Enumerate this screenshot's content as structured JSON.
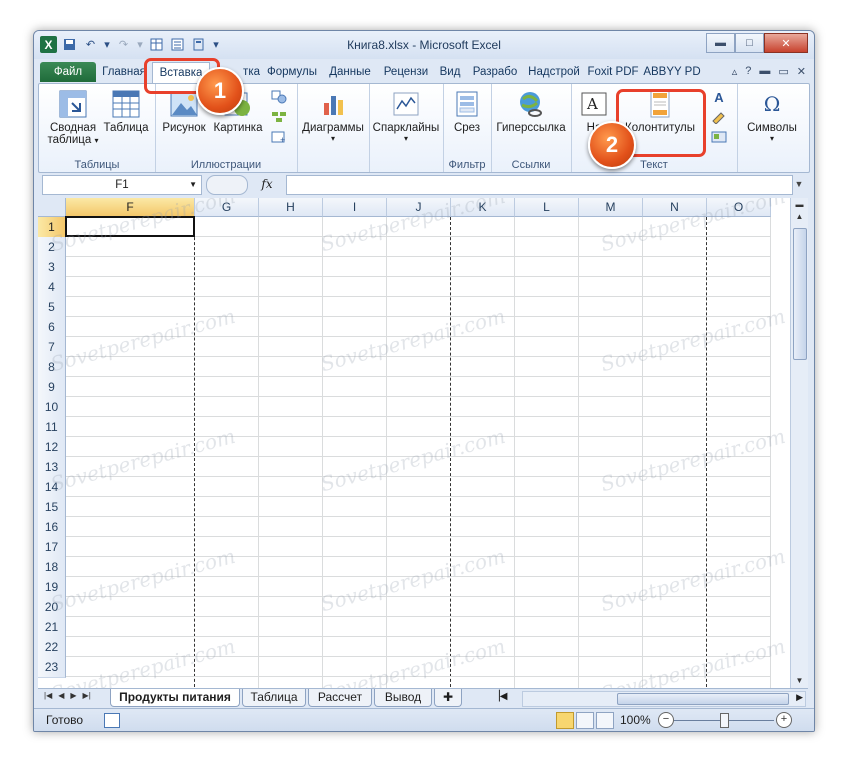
{
  "window": {
    "title": "Книга8.xlsx - Microsoft Excel",
    "controls": {
      "minimize_icon": "minimize-icon",
      "maximize_icon": "maximize-icon",
      "close_icon": "close-icon"
    }
  },
  "ribbon_tabs": [
    "Файл",
    "Главная",
    "Вставка",
    "Разметка",
    "Формулы",
    "Данные",
    "Рецензирование",
    "Вид",
    "Разработчик",
    "Надстройки",
    "Foxit PDF",
    "ABBYY PDF"
  ],
  "ribbon_tabs_visible": [
    "Файл",
    "Главная",
    "Вставка",
    "тка",
    "Формулы",
    "Данные",
    "Рецензи",
    "Вид",
    "Разрабо",
    "Надстрой",
    "Foxit PDF",
    "ABBYY PD"
  ],
  "active_tab": "Вставка",
  "ribbon": {
    "groups": {
      "tables": "Таблицы",
      "illustrations": "Иллюстрации",
      "filter": "Фильтр",
      "links": "Ссылки",
      "text": "Текст"
    },
    "buttons": {
      "pivot_1": "Сводная",
      "pivot_2": "таблица",
      "table": "Таблица",
      "picture": "Рисунок",
      "clipart": "Картинка",
      "charts": "Диаграммы",
      "sparklines": "Спарклайны",
      "slicer": "Срез",
      "hyperlink": "Гиперссылка",
      "textbox": "На",
      "header_footer": "Колонтитулы",
      "symbols": "Символы"
    }
  },
  "formula_bar": {
    "name_box": "F1",
    "fx": "fx",
    "value": ""
  },
  "columns": [
    "F",
    "G",
    "H",
    "I",
    "J",
    "K",
    "L",
    "M",
    "N",
    "O"
  ],
  "rows": [
    "1",
    "2",
    "3",
    "4",
    "5",
    "6",
    "7",
    "8",
    "9",
    "10",
    "11",
    "12",
    "13",
    "14",
    "15",
    "16",
    "17",
    "18",
    "19",
    "20",
    "21",
    "22",
    "23"
  ],
  "active_cell": "F1",
  "sheets": [
    "Продукты питания",
    "Таблица",
    "Рассчет",
    "Вывод"
  ],
  "active_sheet": "Продукты питания",
  "status": {
    "ready": "Готово",
    "zoom": "100%"
  },
  "callouts": [
    "1",
    "2"
  ],
  "watermark": "Sovetperepair.com",
  "colors": {
    "excel_green": "#1f7244",
    "callout": "#e8402b",
    "active_header": "#f4c76a"
  }
}
